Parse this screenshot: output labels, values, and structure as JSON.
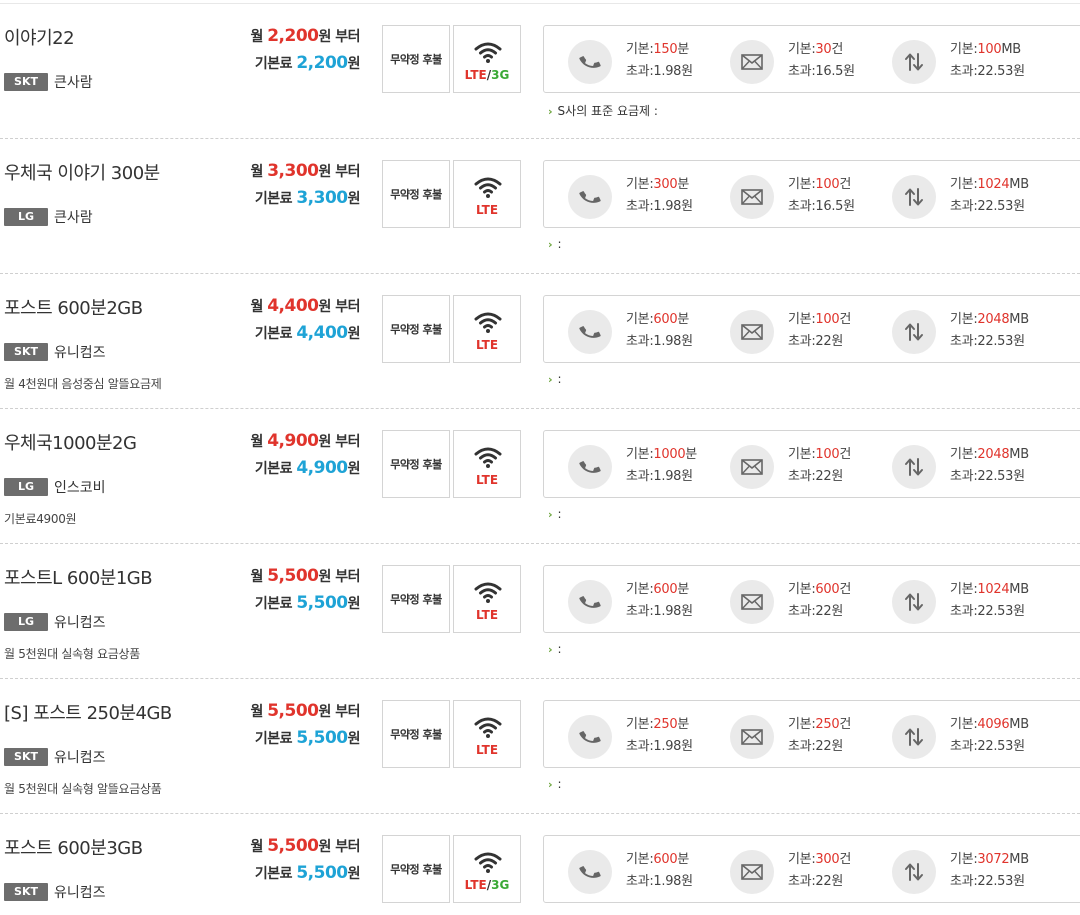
{
  "labels": {
    "price_prefix": "월",
    "price_suffix": "원 부터",
    "base_prefix": "기본료",
    "base_suffix": "원",
    "contract": "무약정 후불",
    "lte": "LTE",
    "slash": "/",
    "threeg": "3G",
    "basic": "기본:",
    "excess": "초과:"
  },
  "colors": {
    "price_red": "#e0342c",
    "base_blue": "#1ea3d6",
    "badge_gray": "#6d6d6d",
    "threeg_green": "#3aa935"
  },
  "icons": [
    "phone-icon",
    "mail-icon",
    "data-transfer-icon",
    "wifi-icon",
    "chevron-right-icon"
  ],
  "plans": [
    {
      "name": "이야기22",
      "carrier": "SKT",
      "mvno": "큰사람",
      "desc": "",
      "monthly": "2,200",
      "base": "2,200",
      "network": "LTE/3G",
      "has_3g": true,
      "voice_base": "150",
      "voice_unit": "분",
      "voice_excess": "1.98원",
      "sms_base": "30",
      "sms_unit": "건",
      "sms_excess": "16.5원",
      "data_base": "100",
      "data_unit": "MB",
      "data_excess": "22.53원",
      "note": "S사의 표준 요금제 :"
    },
    {
      "name": "우체국 이야기 300분",
      "carrier": "LG",
      "mvno": "큰사람",
      "desc": "",
      "monthly": "3,300",
      "base": "3,300",
      "network": "LTE",
      "has_3g": false,
      "voice_base": "300",
      "voice_unit": "분",
      "voice_excess": "1.98원",
      "sms_base": "100",
      "sms_unit": "건",
      "sms_excess": "16.5원",
      "data_base": "1024",
      "data_unit": "MB",
      "data_excess": "22.53원",
      "note": ":"
    },
    {
      "name": "포스트 600분2GB",
      "carrier": "SKT",
      "mvno": "유니컴즈",
      "desc": "월 4천원대 음성중심 알뜰요금제",
      "monthly": "4,400",
      "base": "4,400",
      "network": "LTE",
      "has_3g": false,
      "voice_base": "600",
      "voice_unit": "분",
      "voice_excess": "1.98원",
      "sms_base": "100",
      "sms_unit": "건",
      "sms_excess": "22원",
      "data_base": "2048",
      "data_unit": "MB",
      "data_excess": "22.53원",
      "note": ":"
    },
    {
      "name": "우체국1000분2G",
      "carrier": "LG",
      "mvno": "인스코비",
      "desc": "기본료4900원",
      "monthly": "4,900",
      "base": "4,900",
      "network": "LTE",
      "has_3g": false,
      "voice_base": "1000",
      "voice_unit": "분",
      "voice_excess": "1.98원",
      "sms_base": "100",
      "sms_unit": "건",
      "sms_excess": "22원",
      "data_base": "2048",
      "data_unit": "MB",
      "data_excess": "22.53원",
      "note": ":"
    },
    {
      "name": "포스트L 600분1GB",
      "carrier": "LG",
      "mvno": "유니컴즈",
      "desc": "월 5천원대 실속형 요금상품",
      "monthly": "5,500",
      "base": "5,500",
      "network": "LTE",
      "has_3g": false,
      "voice_base": "600",
      "voice_unit": "분",
      "voice_excess": "1.98원",
      "sms_base": "600",
      "sms_unit": "건",
      "sms_excess": "22원",
      "data_base": "1024",
      "data_unit": "MB",
      "data_excess": "22.53원",
      "note": ":"
    },
    {
      "name": "[S] 포스트 250분4GB",
      "carrier": "SKT",
      "mvno": "유니컴즈",
      "desc": "월 5천원대 실속형 알뜰요금상품",
      "monthly": "5,500",
      "base": "5,500",
      "network": "LTE",
      "has_3g": false,
      "voice_base": "250",
      "voice_unit": "분",
      "voice_excess": "1.98원",
      "sms_base": "250",
      "sms_unit": "건",
      "sms_excess": "22원",
      "data_base": "4096",
      "data_unit": "MB",
      "data_excess": "22.53원",
      "note": ":"
    },
    {
      "name": "포스트 600분3GB",
      "carrier": "SKT",
      "mvno": "유니컴즈",
      "desc": "",
      "monthly": "5,500",
      "base": "5,500",
      "network": "LTE/3G",
      "has_3g": true,
      "voice_base": "600",
      "voice_unit": "분",
      "voice_excess": "1.98원",
      "sms_base": "300",
      "sms_unit": "건",
      "sms_excess": "22원",
      "data_base": "3072",
      "data_unit": "MB",
      "data_excess": "22.53원",
      "note": ""
    }
  ]
}
